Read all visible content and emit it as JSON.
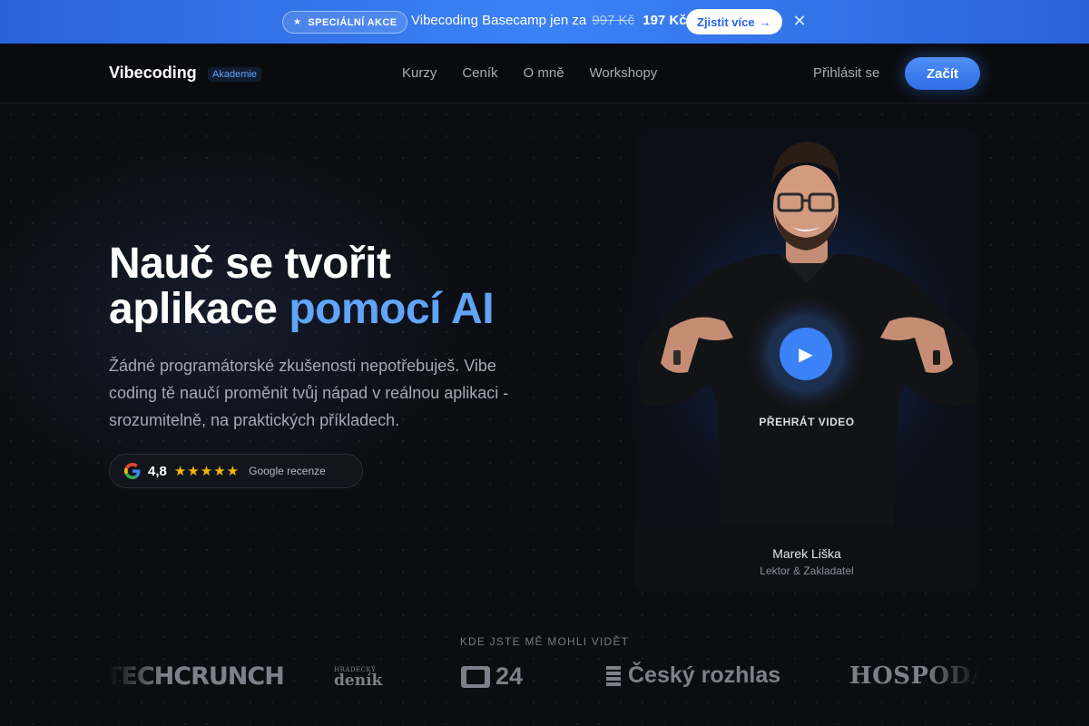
{
  "promo": {
    "badge": "SPECIÁLNÍ AKCE",
    "text": "Vibecoding Basecamp jen za",
    "old_price": "997 Kč",
    "new_price": "197 Kč",
    "cta": "Zjistit více"
  },
  "nav": {
    "brand": "Vibecoding",
    "brand_tag": "Akademie",
    "links": [
      "Kurzy",
      "Ceník",
      "O mně",
      "Workshopy"
    ],
    "login": "Přihlásit se",
    "start": "Začít"
  },
  "hero": {
    "title_line1": "Nauč se tvořit",
    "title_line2_plain": "aplikace",
    "title_line2_accent": "pomocí AI",
    "subtitle": "Žádné programátorské zkušenosti nepotřebuješ. Vibe coding tě naučí proměnit tvůj nápad v reálnou aplikaci - srozumitelně, na praktických příkladech.",
    "rating_value": "4,8",
    "rating_stars": "★★★★★",
    "rating_label": "Google recenze"
  },
  "video": {
    "play_label": "PŘEHRÁT VIDEO",
    "name": "Marek Liška",
    "role": "Lektor & Zakladatel"
  },
  "press": {
    "title": "KDE JSTE MĚ MOHLI VIDĚT",
    "logos": {
      "techcrunch": "TECHCRUNCH",
      "denik_small": "HRADECKÝ",
      "denik_big": "deník",
      "ct24": "24",
      "rozhlas": "Český rozhlas",
      "hospodar": "HOSPODÁŘ"
    }
  },
  "colors": {
    "accent": "#3b82f6",
    "accent_light": "#60a5fa",
    "background": "#0b0d12",
    "star": "#f5b70a"
  }
}
